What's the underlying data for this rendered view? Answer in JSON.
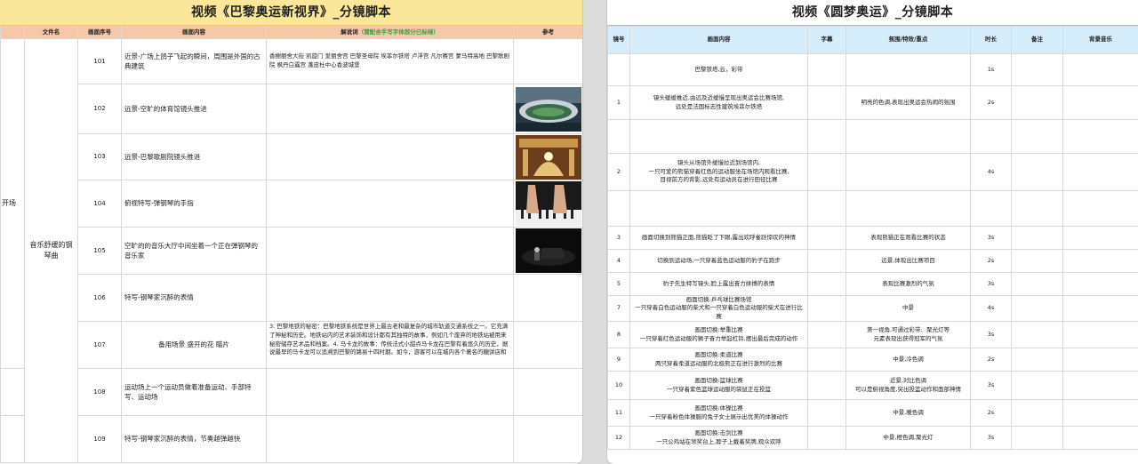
{
  "left": {
    "title": "视频《巴黎奥运新视界》_分镜脚本",
    "headers": {
      "filename": "文件名",
      "shot_no": "画面序号",
      "content": "画面内容",
      "narration": "解说词",
      "narration_note": "（需配合手写字体部分已标绿）",
      "reference": "参考"
    },
    "section_label": "开场",
    "music": "音乐舒缓的钢琴曲",
    "rows": [
      {
        "no": "101",
        "content": "近景-广场上鸽子飞起的瞬间，周围是外国的古典建筑",
        "narration": "香榭丽舍大街 凯旋门 爱丽舍宫 巴黎圣母院 埃菲尔铁塔 卢浮宫 凡尔赛宫 蒙马特高地 巴黎歌剧院 枫丹白露宫 蓬皮杜中心香波城堡"
      },
      {
        "no": "102",
        "content": "远景-空旷的体育馆镜头推进",
        "narration": ""
      },
      {
        "no": "103",
        "content": "远景-巴黎歌剧院镜头推进",
        "narration": ""
      },
      {
        "no": "104",
        "content": "俯视特写-弹钢琴的手指",
        "narration": ""
      },
      {
        "no": "105",
        "content": "空旷的的音乐大厅中间坐着一个正在弹钢琴的音乐家",
        "narration": ""
      },
      {
        "no": "106",
        "content": "特写-钢琴家沉醉的表情",
        "narration": ""
      },
      {
        "no": "107",
        "content": "备用场景 盛开的花 瞄片",
        "narration": "3. 巴黎地铁的秘密：巴黎地铁系统是世界上最古老和最复杂的城市轨道交通系统之一。它充满了神秘和历史。地铁站内的艺术装饰和设计都有其独特的故事，例如几个废弃的地铁站被用来秘密储存艺术品和档案。4. 马卡龙的故事：传统法式小甜点马卡龙在巴黎有着悠久的历史，据说最早的马卡龙可以追溯到巴黎的路易十四时期。如今，游客可以在城内各个著名的糖饼店和"
      },
      {
        "no": "108",
        "content": "运动场上一个运动员做着准备运动、手部特写、运动场",
        "narration": ""
      },
      {
        "no": "109",
        "content": "特写-钢琴家沉醉的表情，节奏越弹越快",
        "narration": ""
      }
    ]
  },
  "right": {
    "title": "视频《圆梦奥运》_分镜脚本",
    "headers": {
      "shot": "镜号",
      "content": "画面内容",
      "caption": "字幕",
      "mood": "氛围/特效/重点",
      "duration": "时长",
      "remarks": "备注",
      "bgm": "背景音乐"
    },
    "rows": [
      {
        "no": "",
        "content": "巴黎铁塔,云，彩带",
        "mood": "",
        "duration": "1s"
      },
      {
        "no": "1",
        "content": "镜头缓缓推近,由远及近缓慢呈现出奥运会比赛场馆,\n远处是法国标志性建筑埃菲尔铁塔",
        "mood": "明亮的色调,表现出奥运会热闹的氛围",
        "duration": "2s"
      },
      {
        "no": "",
        "content": "",
        "mood": "",
        "duration": ""
      },
      {
        "no": "2",
        "content": "镜头从场馆外缓慢拉近到场馆内,\n一只可爱的熊猫穿着红色的运动服坐在场馆内观看比赛,\n目视前方的背影,远处有运动员在进行田径比赛",
        "mood": "",
        "duration": "4s"
      },
      {
        "no": "",
        "content": "",
        "mood": "",
        "duration": ""
      },
      {
        "no": "3",
        "content": "画面切换到熊猫正面,熊猫眨了下眼,露出欢呼雀跃惊叹的神情",
        "mood": "表现熊猫正在观看比赛的状态",
        "duration": "3s"
      },
      {
        "no": "4",
        "content": "切换到运动场,一只穿着蓝色运动服的豹子在跑步",
        "mood": "远景,体现出比赛项目",
        "duration": "2s"
      },
      {
        "no": "5",
        "content": "豹子先生特写镜头,脸上露出奋力拼搏的表情",
        "mood": "表现比赛激烈的气氛",
        "duration": "3s"
      },
      {
        "no": "7",
        "content": "画面切换:乒乓球比赛场馆\n一只穿着白色运动服的柴犬和一只穿着白色运动服的柴犬在进行比赛",
        "mood": "中景",
        "duration": "4s"
      },
      {
        "no": "8",
        "content": "画面切换:举重比赛\n一只穿着红色运动服的狮子奋力举起杠铃,摆出最后完成的动作",
        "mood": "第一视角,可通过彩带、聚光灯等\n元素表现出获得冠军的气氛",
        "duration": "3s"
      },
      {
        "no": "9",
        "content": "画面切换:柔道比赛\n两只穿着柔道运动服的北极熊正在进行激烈的比赛",
        "mood": "中景,冷色调",
        "duration": "2s"
      },
      {
        "no": "10",
        "content": "画面切换:篮球比赛\n一只穿着紫色篮球运动服的袋鼠正在投篮",
        "mood": "近景,对比色调\n可以是俯视角度,突出投篮动作和面部神情",
        "duration": "3s"
      },
      {
        "no": "11",
        "content": "画面切换:体操比赛\n一只穿着粉色体操服的兔子女士展示出优美的体操动作",
        "mood": "中景,暖色调",
        "duration": "2s"
      },
      {
        "no": "12",
        "content": "画面切换:击剑比赛\n一只公鸡站在领奖台上,脖子上戴着奖牌,观众欢呼",
        "mood": "中景,橙色调,聚光灯",
        "duration": "3s"
      }
    ]
  },
  "colors": {
    "left_title_bg": "#fbe79a",
    "left_header_bg": "#f6c7a8",
    "right_header_bg": "#d6eefb",
    "note_green": "#3a9d47"
  }
}
